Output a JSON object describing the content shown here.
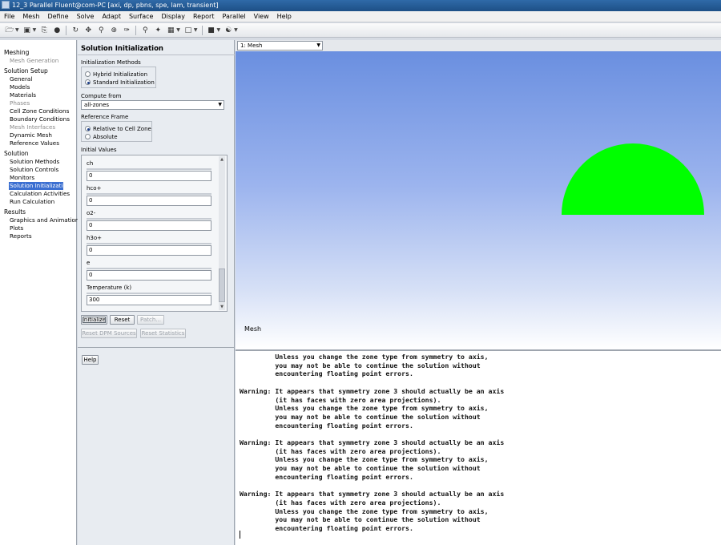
{
  "window": {
    "title": "12_3 Parallel Fluent@com-PC  [axi, dp, pbns, spe, lam, transient]"
  },
  "menu": [
    "File",
    "Mesh",
    "Define",
    "Solve",
    "Adapt",
    "Surface",
    "Display",
    "Report",
    "Parallel",
    "View",
    "Help"
  ],
  "toolbar": [
    "open-file-icon",
    "save-icon",
    "print-icon",
    "help-icon",
    "rotate-icon",
    "translate-icon",
    "zoom-icon",
    "zoom-in-icon",
    "probe-icon",
    "zoom-fit-icon",
    "mouse-settings-icon",
    "layout-icon",
    "view-icon",
    "lights-icon"
  ],
  "nav": {
    "meshing": "Meshing",
    "mesh_generation": "Mesh Generation",
    "solution_setup": "Solution Setup",
    "general": "General",
    "models": "Models",
    "materials": "Materials",
    "phases": "Phases",
    "cell_zone_conditions": "Cell Zone Conditions",
    "boundary_conditions": "Boundary Conditions",
    "mesh_interfaces": "Mesh Interfaces",
    "dynamic_mesh": "Dynamic Mesh",
    "reference_values": "Reference Values",
    "solution": "Solution",
    "solution_methods": "Solution Methods",
    "solution_controls": "Solution Controls",
    "monitors": "Monitors",
    "solution_initialization": "Solution Initialization",
    "calculation_activities": "Calculation Activities",
    "run_calculation": "Run Calculation",
    "results": "Results",
    "graphics_and_animations": "Graphics and Animations",
    "plots": "Plots",
    "reports": "Reports"
  },
  "panel": {
    "title": "Solution Initialization",
    "init_methods_label": "Initialization Methods",
    "hybrid": "Hybrid  Initialization",
    "standard": "Standard Initialization",
    "compute_from_label": "Compute from",
    "compute_from_value": "all-zones",
    "reference_frame_label": "Reference Frame",
    "relative": "Relative to Cell Zone",
    "absolute": "Absolute",
    "initial_values_label": "Initial Values",
    "fields": [
      {
        "name": "ch",
        "value": "0"
      },
      {
        "name": "hco+",
        "value": "0"
      },
      {
        "name": "o2-",
        "value": "0"
      },
      {
        "name": "h3o+",
        "value": "0"
      },
      {
        "name": "e",
        "value": "0"
      },
      {
        "name": "Temperature (k)",
        "value": "300"
      }
    ],
    "initialize": "Initialize",
    "reset": "Reset",
    "patch": "Patch...",
    "reset_dpm": "Reset DPM Sources",
    "reset_stats": "Reset Statistics",
    "help": "Help"
  },
  "graphics": {
    "window_select": "1: Mesh",
    "label": "Mesh",
    "shape_color": "#00ff00"
  },
  "console": {
    "lines": [
      "         Unless you change the zone type from symmetry to axis,",
      "         you may not be able to continue the solution without",
      "         encountering floating point errors.",
      "",
      "Warning: It appears that symmetry zone 3 should actually be an axis",
      "         (it has faces with zero area projections).",
      "         Unless you change the zone type from symmetry to axis,",
      "         you may not be able to continue the solution without",
      "         encountering floating point errors.",
      "",
      "Warning: It appears that symmetry zone 3 should actually be an axis",
      "         (it has faces with zero area projections).",
      "         Unless you change the zone type from symmetry to axis,",
      "         you may not be able to continue the solution without",
      "         encountering floating point errors.",
      "",
      "Warning: It appears that symmetry zone 3 should actually be an axis",
      "         (it has faces with zero area projections).",
      "         Unless you change the zone type from symmetry to axis,",
      "         you may not be able to continue the solution without",
      "         encountering floating point errors."
    ]
  }
}
